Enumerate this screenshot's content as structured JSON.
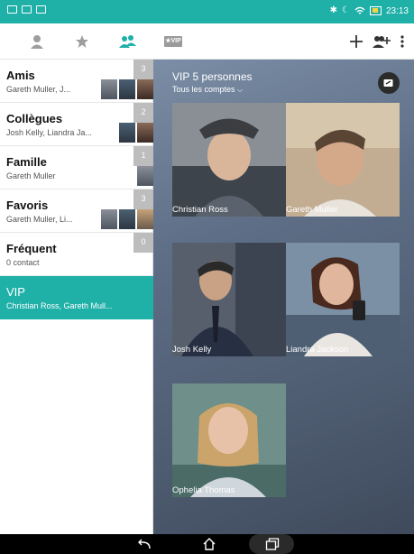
{
  "statusbar": {
    "time": "23:13",
    "icons": [
      "bluetooth-icon",
      "moon-icon",
      "wifi-icon",
      "battery-icon"
    ]
  },
  "toolbar": {
    "tabs": [
      "person-icon",
      "star-icon",
      "group-icon"
    ],
    "vip_badge": "★VIP",
    "actions": [
      "add-icon",
      "add-group-icon",
      "more-icon"
    ]
  },
  "groups": [
    {
      "name": "Amis",
      "members": "Gareth Muller, J...",
      "count": "3"
    },
    {
      "name": "Collègues",
      "members": "Josh Kelly, Liandra Ja...",
      "count": "2"
    },
    {
      "name": "Famille",
      "members": "Gareth Muller",
      "count": "1"
    },
    {
      "name": "Favoris",
      "members": "Gareth Muller, Li...",
      "count": "3"
    },
    {
      "name": "Fréquent",
      "members": "0 contact",
      "count": "0"
    },
    {
      "name": "VIP",
      "members": "Christian Ross, Gareth Mull...",
      "count": ""
    }
  ],
  "detail": {
    "title": "VIP 5 personnes",
    "subtitle": "Tous les comptes",
    "contacts": [
      {
        "name": "Christian Ross"
      },
      {
        "name": "Gareth Muller"
      },
      {
        "name": "Josh Kelly"
      },
      {
        "name": "Liandra Jackson"
      },
      {
        "name": "Ophelia Thomas"
      }
    ]
  },
  "colors": {
    "accent": "#1fb0a8",
    "count_badge": "#bdbdbd"
  }
}
